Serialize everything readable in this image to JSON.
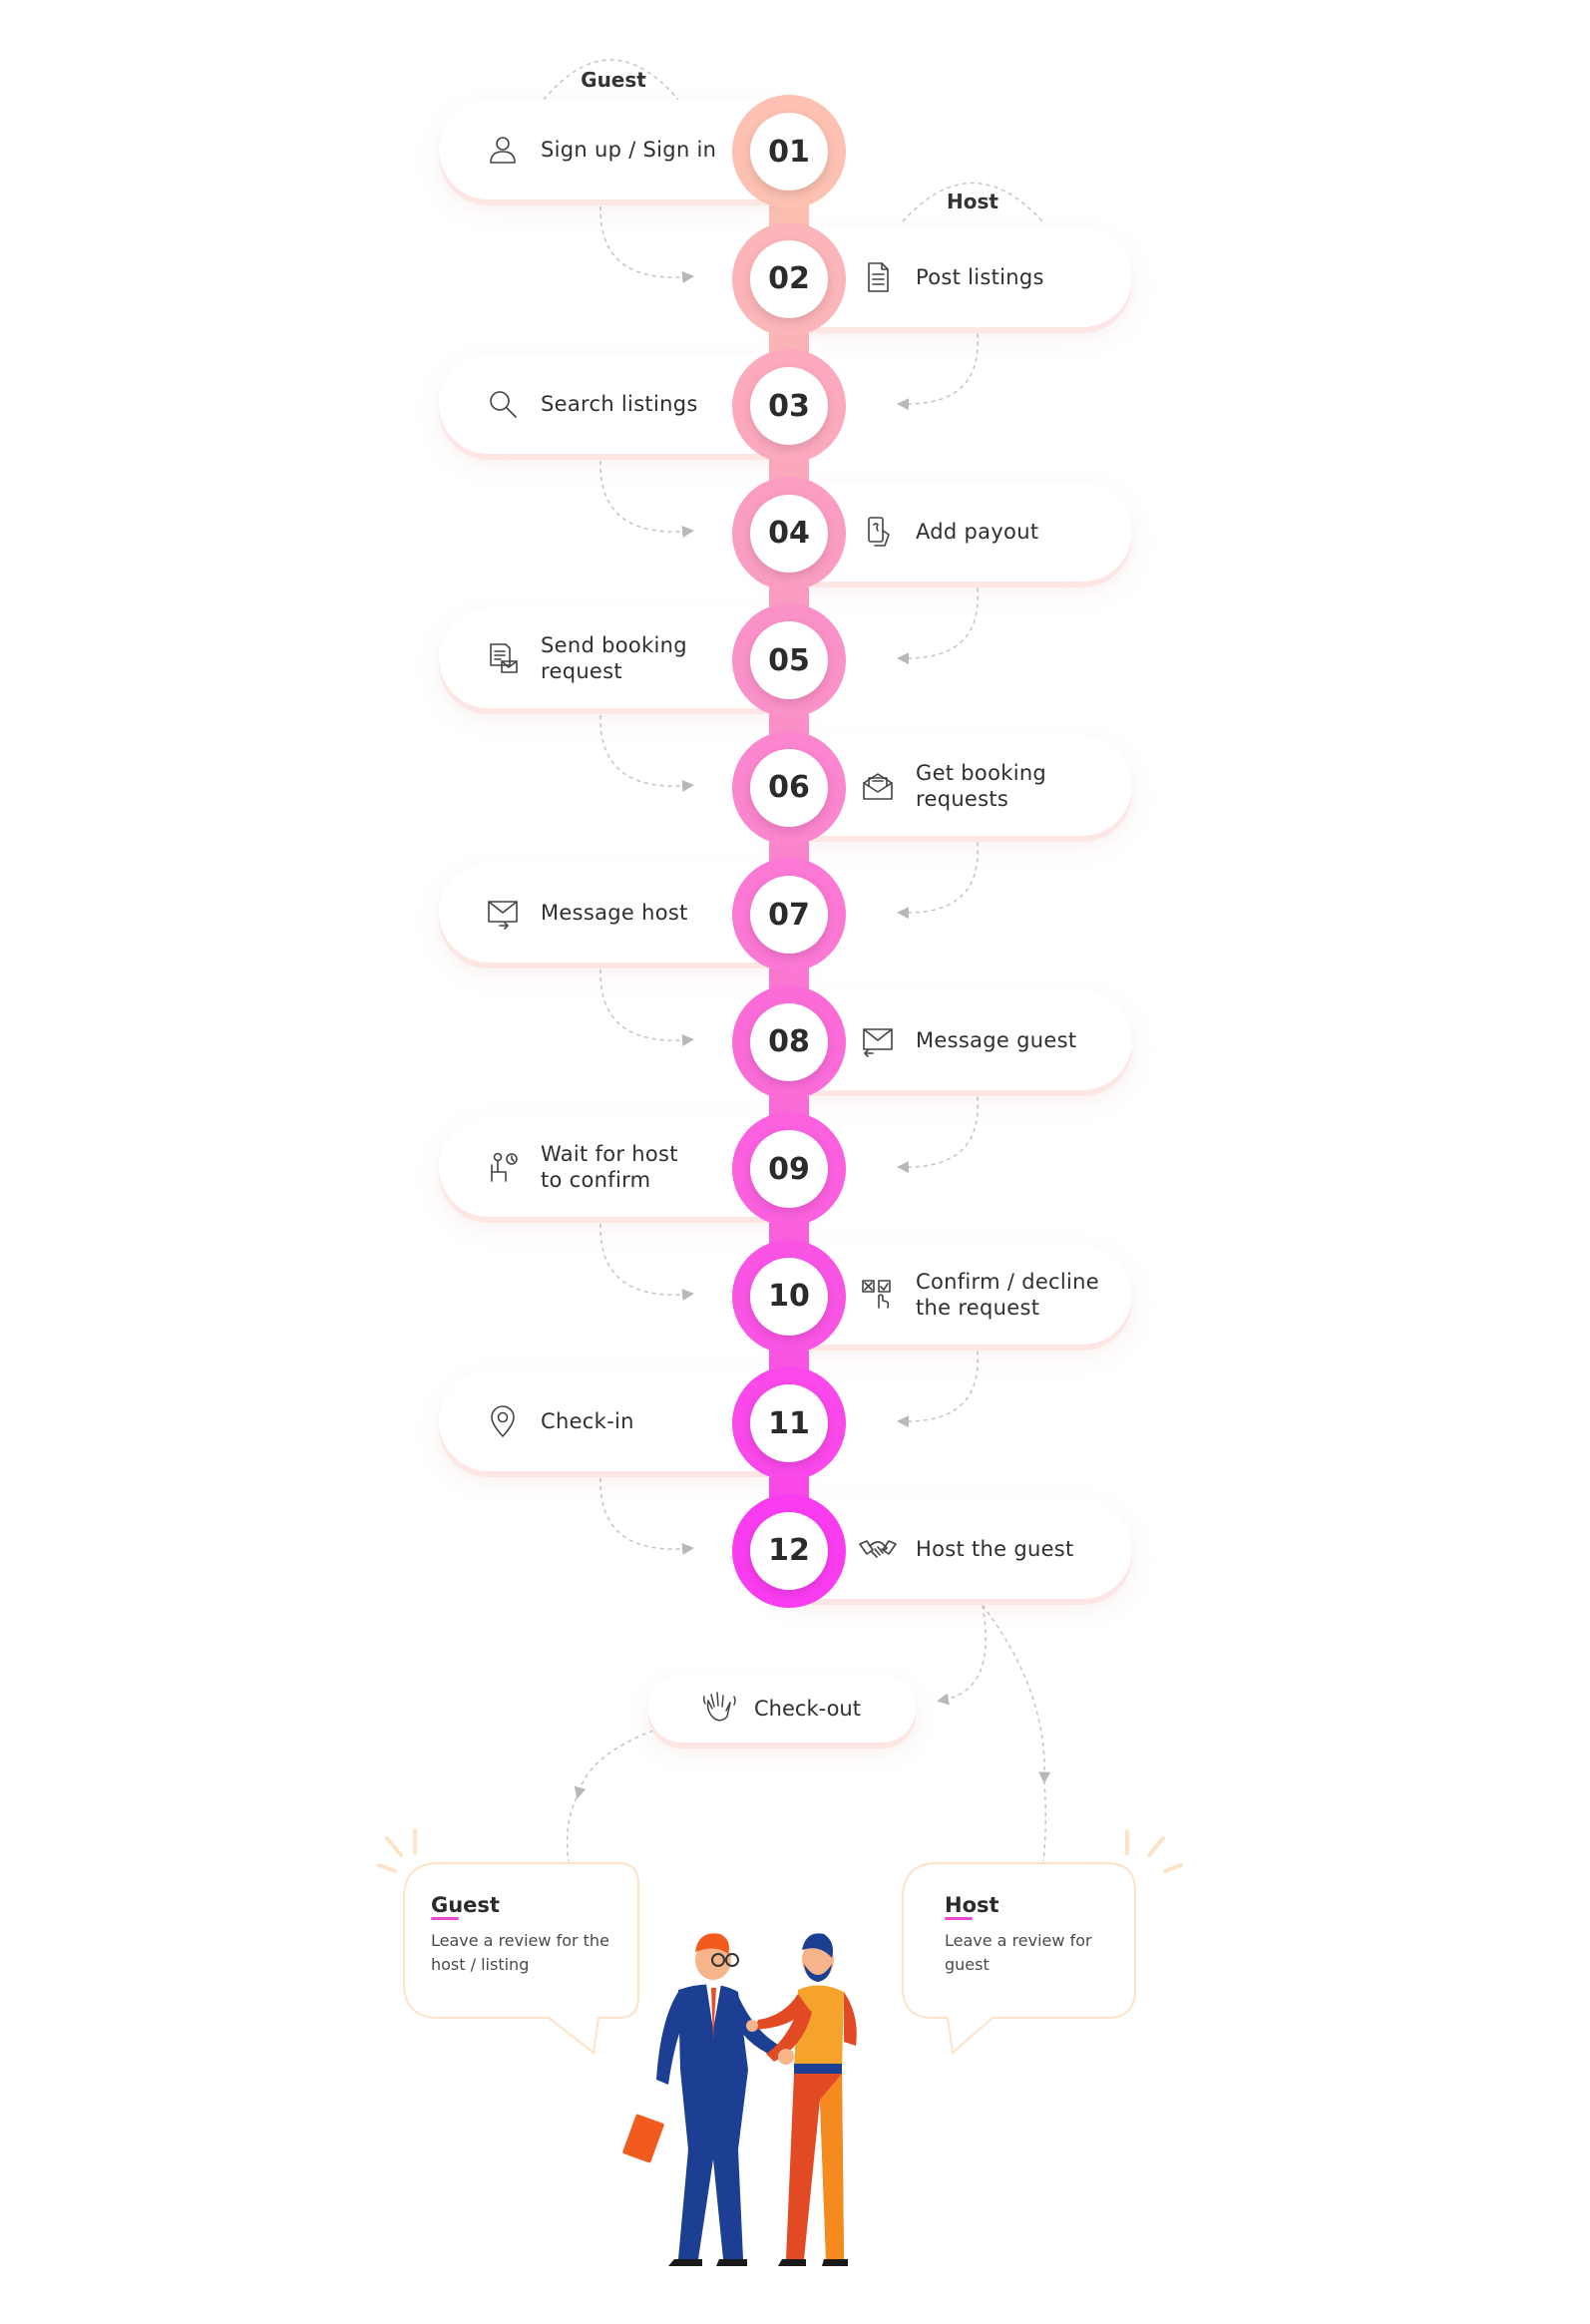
{
  "roles": {
    "guest": "Guest",
    "host": "Host"
  },
  "steps": [
    {
      "num": "01",
      "label": "Sign up / Sign in",
      "side": "left",
      "icon": "user-icon"
    },
    {
      "num": "02",
      "label": "Post listings",
      "side": "right",
      "icon": "document-list-icon"
    },
    {
      "num": "03",
      "label": "Search listings",
      "side": "left",
      "icon": "search-icon"
    },
    {
      "num": "04",
      "label": "Add payout",
      "side": "right",
      "icon": "payout-icon"
    },
    {
      "num": "05",
      "label": "Send booking\nrequest",
      "side": "left",
      "icon": "booking-request-icon"
    },
    {
      "num": "06",
      "label": "Get booking\nrequests",
      "side": "right",
      "icon": "open-envelope-icon"
    },
    {
      "num": "07",
      "label": "Message host",
      "side": "left",
      "icon": "envelope-send-icon"
    },
    {
      "num": "08",
      "label": "Message guest",
      "side": "right",
      "icon": "envelope-receive-icon"
    },
    {
      "num": "09",
      "label": "Wait for host\nto confirm",
      "side": "left",
      "icon": "waiting-person-icon"
    },
    {
      "num": "10",
      "label": "Confirm / decline\nthe request",
      "side": "right",
      "icon": "confirm-decline-icon"
    },
    {
      "num": "11",
      "label": "Check-in",
      "side": "left",
      "icon": "location-pin-icon"
    },
    {
      "num": "12",
      "label": "Host the guest",
      "side": "right",
      "icon": "handshake-icon"
    }
  ],
  "checkout": {
    "label": "Check-out",
    "icon": "waving-hand-icon"
  },
  "reviews": {
    "guest": {
      "title": "Guest",
      "text": "Leave a review for the host / listing"
    },
    "host": {
      "title": "Host",
      "text": "Leave a review for guest"
    }
  },
  "colors": {
    "spine_top": "#fcc1b2",
    "spine_bottom": "#fa3cf0",
    "bubble_border": "#fde3c8",
    "accent": "#e94ad6"
  }
}
